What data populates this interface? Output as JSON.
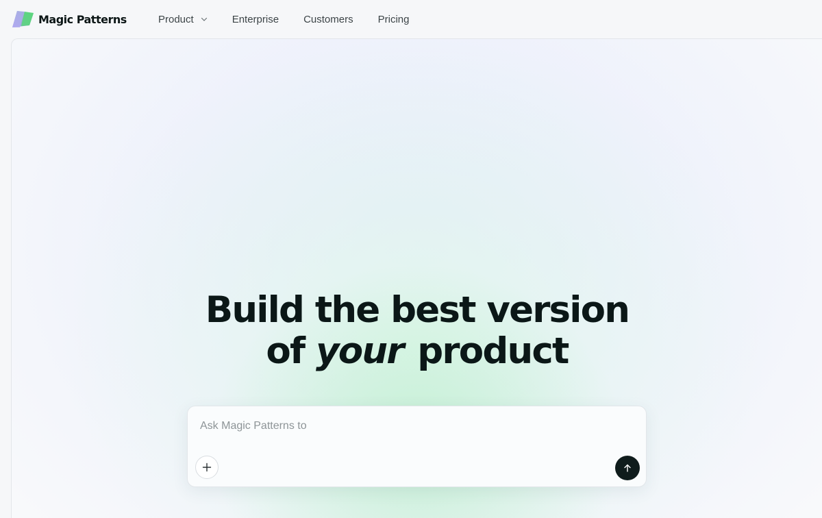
{
  "brand": {
    "name": "Magic Patterns",
    "logo_icon": "magic-patterns-logo-icon"
  },
  "nav": {
    "items": [
      {
        "label": "Product",
        "has_dropdown": true
      },
      {
        "label": "Enterprise"
      },
      {
        "label": "Customers"
      },
      {
        "label": "Pricing"
      }
    ]
  },
  "hero": {
    "headline_line1": "Build the best version",
    "headline_line2_before": "of",
    "headline_line2_emphasis": "your",
    "headline_line2_after": "product"
  },
  "prompt": {
    "placeholder": "Ask Magic Patterns to",
    "value": "",
    "add_icon": "plus-icon",
    "send_icon": "arrow-up-icon"
  },
  "colors": {
    "accent_dark": "#0f1c1c",
    "brand_green": "#5cd684",
    "brand_purple": "#a7a1e8"
  }
}
